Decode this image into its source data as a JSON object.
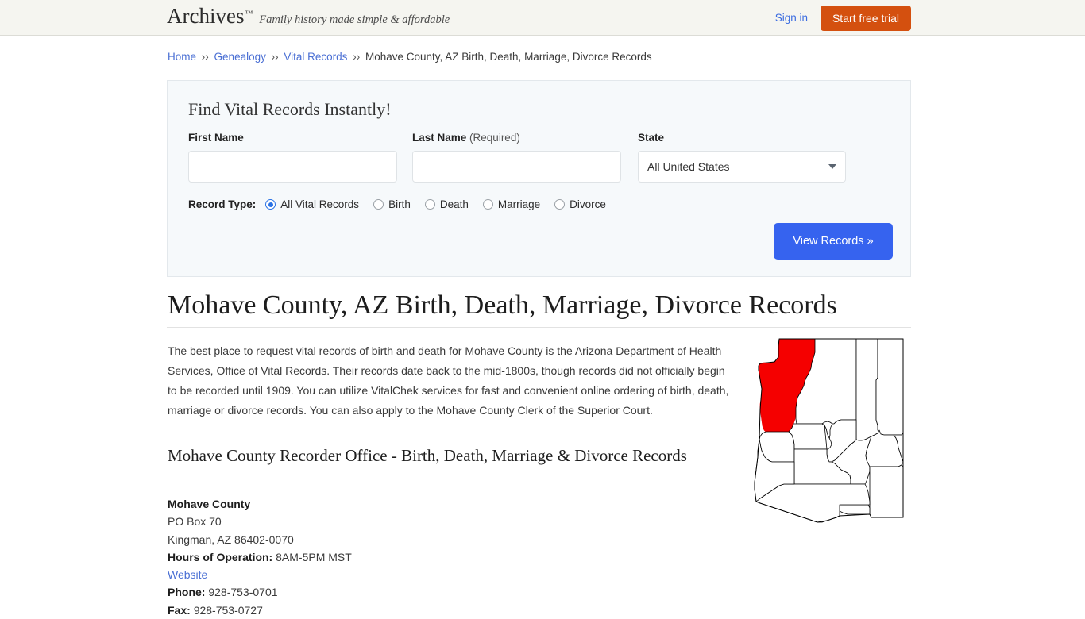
{
  "header": {
    "brand_name": "Archives",
    "brand_tm": "™",
    "tagline": "Family history made simple & affordable",
    "signin_label": "Sign in",
    "trial_label": "Start free trial",
    "brand_accent": "#d4500f"
  },
  "breadcrumb": {
    "items": [
      {
        "label": "Home",
        "link": true
      },
      {
        "label": "Genealogy",
        "link": true
      },
      {
        "label": "Vital Records",
        "link": true
      },
      {
        "label": "Mohave County, AZ Birth, Death, Marriage, Divorce Records",
        "link": false
      }
    ],
    "separator": "››"
  },
  "search": {
    "title": "Find Vital Records Instantly!",
    "first_name": {
      "label": "First Name",
      "value": "",
      "placeholder": ""
    },
    "last_name": {
      "label": "Last Name",
      "required_note": "(Required)",
      "value": "",
      "placeholder": ""
    },
    "state": {
      "label": "State",
      "selected": "All United States"
    },
    "record_type": {
      "label": "Record Type:",
      "options": [
        {
          "label": "All Vital Records",
          "checked": true
        },
        {
          "label": "Birth",
          "checked": false
        },
        {
          "label": "Death",
          "checked": false
        },
        {
          "label": "Marriage",
          "checked": false
        },
        {
          "label": "Divorce",
          "checked": false
        }
      ]
    },
    "submit_label": "View Records »",
    "submit_color": "#3663ef"
  },
  "main": {
    "page_title": "Mohave County, AZ Birth, Death, Marriage, Divorce Records",
    "paragraph": "The best place to request vital records of birth and death for Mohave County is the Arizona Department of Health Services, Office of Vital Records. Their records date back to the mid-1800s, though records did not officially begin to be recorded until 1909. You can utilize VitalChek services for fast and convenient online ordering of birth, death, marriage or divorce records. You can also apply to the Mohave County Clerk of the Superior Court.",
    "sub_title": "Mohave County Recorder Office - Birth, Death, Marriage & Divorce Records",
    "address": {
      "name": "Mohave County",
      "street": "PO Box 70",
      "city_state_zip": "Kingman, AZ 86402-0070",
      "hours_label": "Hours of Operation:",
      "hours_value": "8AM-5PM MST",
      "website_label": "Website",
      "phone_label": "Phone:",
      "phone_value": "928-753-0701",
      "fax_label": "Fax:",
      "fax_value": "928-753-0727"
    },
    "map": {
      "state": "Arizona",
      "highlighted_county": "Mohave County",
      "highlight_color": "#f50000",
      "outline_color": "#000000"
    }
  }
}
